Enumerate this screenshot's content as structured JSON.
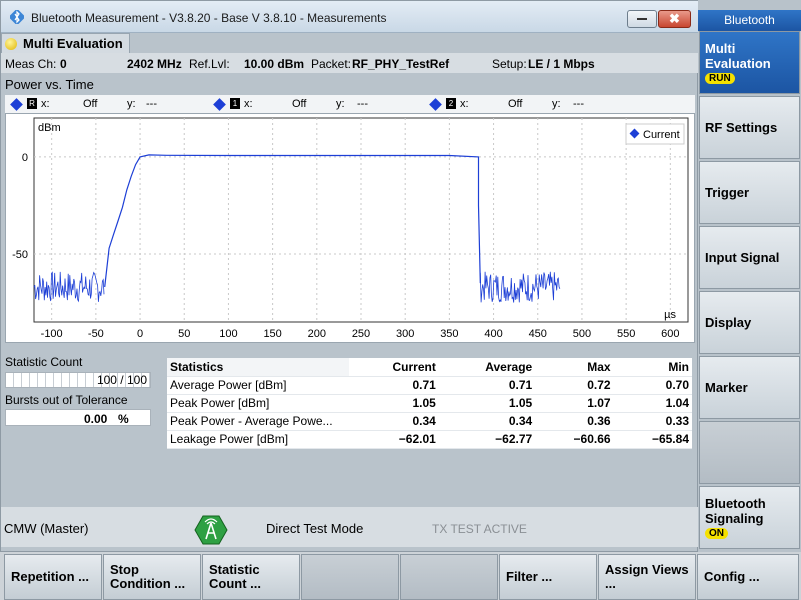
{
  "window": {
    "title": "Bluetooth Measurement  - V3.8.20 - Base V 3.8.10 - Measurements",
    "close_glyph": "✖"
  },
  "tab": {
    "label": "Multi Evaluation"
  },
  "info": {
    "meas_ch_label": "Meas Ch:",
    "meas_ch_value": "0",
    "freq": "2402 MHz",
    "ref_lvl_label": "Ref.Lvl:",
    "ref_lvl_value": "10.00 dBm",
    "packet_label": "Packet:",
    "packet_value": "RF_PHY_TestRef",
    "setup_label": "Setup:",
    "setup_value": "LE / 1 Mbps"
  },
  "panel_title": "Power vs. Time",
  "markers": [
    {
      "id": "R",
      "x_label": "x:",
      "x_value": "Off",
      "y_label": "y:",
      "y_value": "---"
    },
    {
      "id": "1",
      "x_label": "x:",
      "x_value": "Off",
      "y_label": "y:",
      "y_value": "---"
    },
    {
      "id": "2",
      "x_label": "x:",
      "x_value": "Off",
      "y_label": "y:",
      "y_value": "---"
    }
  ],
  "chart_data": {
    "type": "line",
    "ylabel": "dBm",
    "xlabel": "µs",
    "xlim": [
      -120,
      620
    ],
    "ylim": [
      -85,
      20
    ],
    "x_ticks": [
      -100,
      -50,
      0,
      50,
      100,
      150,
      200,
      250,
      300,
      350,
      400,
      450,
      500,
      550,
      600
    ],
    "y_ticks": [
      0,
      -50
    ],
    "grid": true,
    "legend": "top-right",
    "series": [
      {
        "name": "Current",
        "color": "#1d3fd6",
        "x": [
          -120,
          -40,
          -35,
          -30,
          -25,
          -20,
          -15,
          -10,
          -5,
          0,
          10,
          30,
          100,
          200,
          300,
          350,
          383,
          383,
          385,
          390,
          470
        ],
        "y": [
          -67,
          -67,
          -47,
          -40,
          -33,
          -26,
          -17,
          -10,
          -4,
          0,
          1,
          0.8,
          0.7,
          0.7,
          0.7,
          0.7,
          0,
          -25,
          -65,
          -67,
          -67
        ],
        "noise_regions": [
          {
            "x": [
              -120,
              -40
            ],
            "level": -67,
            "spread": 8
          },
          {
            "x": [
              385,
              475
            ],
            "level": -67,
            "spread": 8
          }
        ]
      }
    ]
  },
  "stat_count": {
    "label": "Statistic Count",
    "value": "100 / 100"
  },
  "bursts": {
    "label": "Bursts out of Tolerance",
    "value": "0.00",
    "unit": "%"
  },
  "stats": {
    "headers": [
      "Statistics",
      "Current",
      "Average",
      "Max",
      "Min"
    ],
    "rows": [
      [
        "Average Power [dBm]",
        "0.71",
        "0.71",
        "0.72",
        "0.70"
      ],
      [
        "Peak Power [dBm]",
        "1.05",
        "1.05",
        "1.07",
        "1.04"
      ],
      [
        "Peak Power - Average Powe...",
        "0.34",
        "0.34",
        "0.36",
        "0.33"
      ],
      [
        "Leakage Power [dBm]",
        "−62.01",
        "−62.77",
        "−60.66",
        "−65.84"
      ]
    ]
  },
  "status": {
    "instrument": "CMW (Master)",
    "mode": "Direct Test Mode",
    "state": "TX TEST ACTIVE",
    "state_color": "#8a8f94"
  },
  "sidebar": {
    "title": "Bluetooth",
    "buttons": [
      {
        "label": "Multi Evaluation",
        "badge": "RUN"
      },
      {
        "label": "RF Settings"
      },
      {
        "label": "Trigger"
      },
      {
        "label": "Input Signal"
      },
      {
        "label": "Display"
      },
      {
        "label": "Marker"
      },
      {
        "label": ""
      },
      {
        "label": "Bluetooth Signaling",
        "badge": "ON"
      }
    ]
  },
  "softkeys": [
    "Repetition ...",
    "Stop Condition ...",
    "Statistic Count ...",
    "",
    "",
    "Filter ...",
    "Assign Views ...",
    "Config ..."
  ]
}
